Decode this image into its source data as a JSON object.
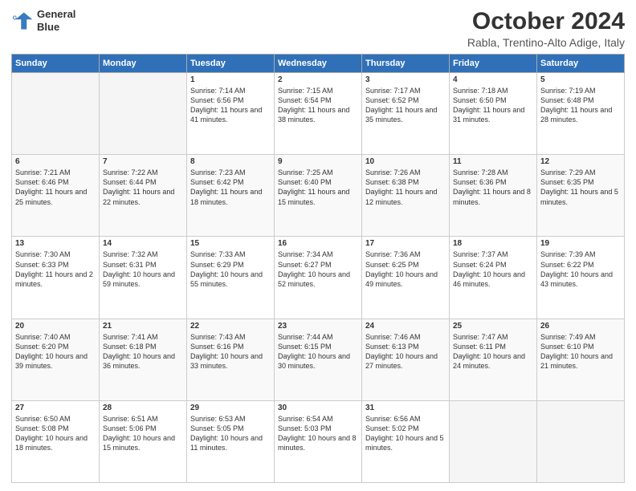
{
  "header": {
    "logo_line1": "General",
    "logo_line2": "Blue",
    "month": "October 2024",
    "location": "Rabla, Trentino-Alto Adige, Italy"
  },
  "days_of_week": [
    "Sunday",
    "Monday",
    "Tuesday",
    "Wednesday",
    "Thursday",
    "Friday",
    "Saturday"
  ],
  "weeks": [
    [
      {
        "day": "",
        "content": ""
      },
      {
        "day": "",
        "content": ""
      },
      {
        "day": "1",
        "content": "Sunrise: 7:14 AM\nSunset: 6:56 PM\nDaylight: 11 hours and 41 minutes."
      },
      {
        "day": "2",
        "content": "Sunrise: 7:15 AM\nSunset: 6:54 PM\nDaylight: 11 hours and 38 minutes."
      },
      {
        "day": "3",
        "content": "Sunrise: 7:17 AM\nSunset: 6:52 PM\nDaylight: 11 hours and 35 minutes."
      },
      {
        "day": "4",
        "content": "Sunrise: 7:18 AM\nSunset: 6:50 PM\nDaylight: 11 hours and 31 minutes."
      },
      {
        "day": "5",
        "content": "Sunrise: 7:19 AM\nSunset: 6:48 PM\nDaylight: 11 hours and 28 minutes."
      }
    ],
    [
      {
        "day": "6",
        "content": "Sunrise: 7:21 AM\nSunset: 6:46 PM\nDaylight: 11 hours and 25 minutes."
      },
      {
        "day": "7",
        "content": "Sunrise: 7:22 AM\nSunset: 6:44 PM\nDaylight: 11 hours and 22 minutes."
      },
      {
        "day": "8",
        "content": "Sunrise: 7:23 AM\nSunset: 6:42 PM\nDaylight: 11 hours and 18 minutes."
      },
      {
        "day": "9",
        "content": "Sunrise: 7:25 AM\nSunset: 6:40 PM\nDaylight: 11 hours and 15 minutes."
      },
      {
        "day": "10",
        "content": "Sunrise: 7:26 AM\nSunset: 6:38 PM\nDaylight: 11 hours and 12 minutes."
      },
      {
        "day": "11",
        "content": "Sunrise: 7:28 AM\nSunset: 6:36 PM\nDaylight: 11 hours and 8 minutes."
      },
      {
        "day": "12",
        "content": "Sunrise: 7:29 AM\nSunset: 6:35 PM\nDaylight: 11 hours and 5 minutes."
      }
    ],
    [
      {
        "day": "13",
        "content": "Sunrise: 7:30 AM\nSunset: 6:33 PM\nDaylight: 11 hours and 2 minutes."
      },
      {
        "day": "14",
        "content": "Sunrise: 7:32 AM\nSunset: 6:31 PM\nDaylight: 10 hours and 59 minutes."
      },
      {
        "day": "15",
        "content": "Sunrise: 7:33 AM\nSunset: 6:29 PM\nDaylight: 10 hours and 55 minutes."
      },
      {
        "day": "16",
        "content": "Sunrise: 7:34 AM\nSunset: 6:27 PM\nDaylight: 10 hours and 52 minutes."
      },
      {
        "day": "17",
        "content": "Sunrise: 7:36 AM\nSunset: 6:25 PM\nDaylight: 10 hours and 49 minutes."
      },
      {
        "day": "18",
        "content": "Sunrise: 7:37 AM\nSunset: 6:24 PM\nDaylight: 10 hours and 46 minutes."
      },
      {
        "day": "19",
        "content": "Sunrise: 7:39 AM\nSunset: 6:22 PM\nDaylight: 10 hours and 43 minutes."
      }
    ],
    [
      {
        "day": "20",
        "content": "Sunrise: 7:40 AM\nSunset: 6:20 PM\nDaylight: 10 hours and 39 minutes."
      },
      {
        "day": "21",
        "content": "Sunrise: 7:41 AM\nSunset: 6:18 PM\nDaylight: 10 hours and 36 minutes."
      },
      {
        "day": "22",
        "content": "Sunrise: 7:43 AM\nSunset: 6:16 PM\nDaylight: 10 hours and 33 minutes."
      },
      {
        "day": "23",
        "content": "Sunrise: 7:44 AM\nSunset: 6:15 PM\nDaylight: 10 hours and 30 minutes."
      },
      {
        "day": "24",
        "content": "Sunrise: 7:46 AM\nSunset: 6:13 PM\nDaylight: 10 hours and 27 minutes."
      },
      {
        "day": "25",
        "content": "Sunrise: 7:47 AM\nSunset: 6:11 PM\nDaylight: 10 hours and 24 minutes."
      },
      {
        "day": "26",
        "content": "Sunrise: 7:49 AM\nSunset: 6:10 PM\nDaylight: 10 hours and 21 minutes."
      }
    ],
    [
      {
        "day": "27",
        "content": "Sunrise: 6:50 AM\nSunset: 5:08 PM\nDaylight: 10 hours and 18 minutes."
      },
      {
        "day": "28",
        "content": "Sunrise: 6:51 AM\nSunset: 5:06 PM\nDaylight: 10 hours and 15 minutes."
      },
      {
        "day": "29",
        "content": "Sunrise: 6:53 AM\nSunset: 5:05 PM\nDaylight: 10 hours and 11 minutes."
      },
      {
        "day": "30",
        "content": "Sunrise: 6:54 AM\nSunset: 5:03 PM\nDaylight: 10 hours and 8 minutes."
      },
      {
        "day": "31",
        "content": "Sunrise: 6:56 AM\nSunset: 5:02 PM\nDaylight: 10 hours and 5 minutes."
      },
      {
        "day": "",
        "content": ""
      },
      {
        "day": "",
        "content": ""
      }
    ]
  ]
}
